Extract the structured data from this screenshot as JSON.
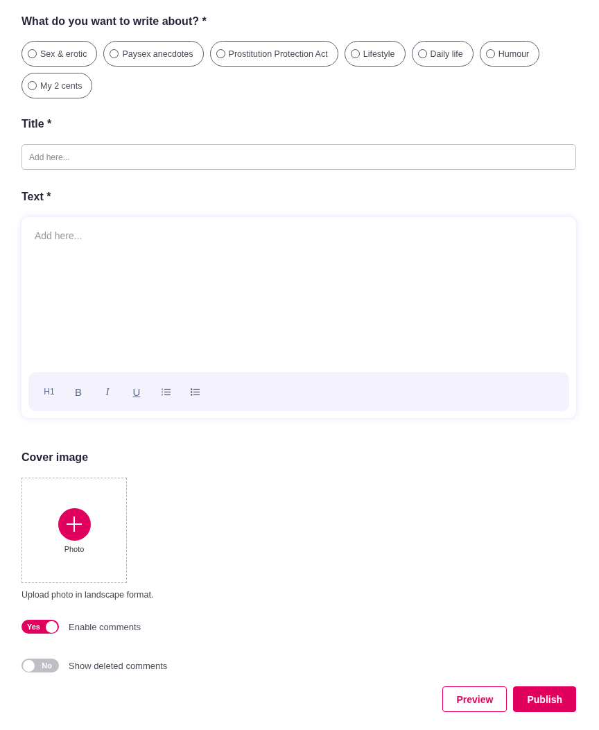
{
  "topics": {
    "label": "What do you want to write about? *",
    "options": [
      {
        "label": "Sex & erotic",
        "selected": false
      },
      {
        "label": "Paysex anecdotes",
        "selected": false
      },
      {
        "label": "Prostitution Protection Act",
        "selected": false
      },
      {
        "label": "Lifestyle",
        "selected": false
      },
      {
        "label": "Daily life",
        "selected": false
      },
      {
        "label": "Humour",
        "selected": false
      },
      {
        "label": "My 2 cents",
        "selected": false
      }
    ]
  },
  "title_field": {
    "label": "Title *",
    "placeholder": "Add here..."
  },
  "text_field": {
    "label": "Text *",
    "placeholder": "Add here...",
    "toolbar": [
      {
        "kind": "heading",
        "label": "H1"
      },
      {
        "kind": "bold",
        "label": "B"
      },
      {
        "kind": "italic",
        "label": "I"
      },
      {
        "kind": "underline",
        "label": "U"
      },
      {
        "kind": "ordered-list"
      },
      {
        "kind": "bullet-list"
      }
    ]
  },
  "cover": {
    "label": "Cover image",
    "button": "Photo",
    "hint": "Upload photo in landscape format."
  },
  "toggles": [
    {
      "state": "Yes",
      "on": true,
      "label": "Enable comments"
    },
    {
      "state": "No",
      "on": false,
      "label": "Show deleted comments"
    }
  ],
  "buttons": [
    {
      "kind": "outline",
      "label": "Preview"
    },
    {
      "kind": "primary",
      "label": "Publish"
    }
  ]
}
